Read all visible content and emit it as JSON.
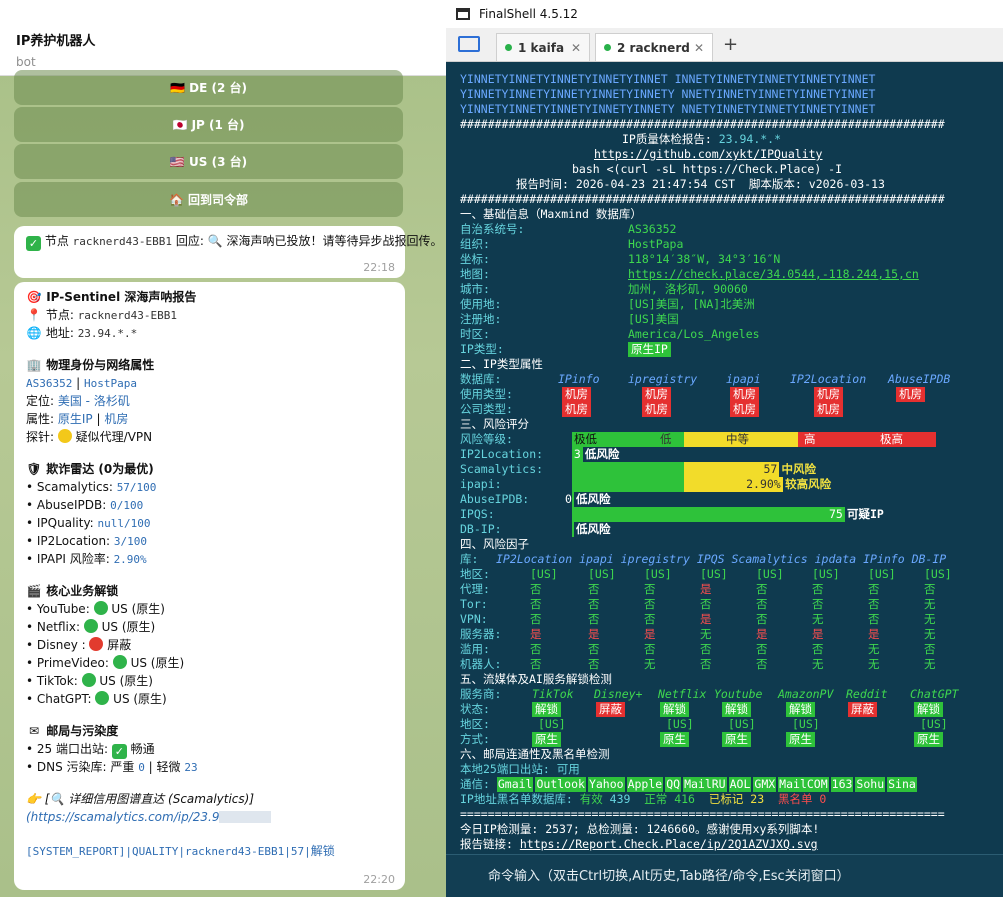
{
  "telegram": {
    "title": "IP养护机器人",
    "subtitle": "bot",
    "buttons": [
      "🇩🇪 DE (2 台)",
      "🇯🇵 JP (1 台)",
      "🇺🇸 US (3 台)",
      "🏠 回到司令部"
    ],
    "msg1": {
      "prefix": "节点 ",
      "node": "racknerd43-EBB1",
      "text1": " 回应: ",
      "text2": " 深海声呐已投放！请等待异步战报回传。",
      "time": "22:18"
    },
    "report": {
      "title": "IP-Sentinel 深海声呐报告",
      "node_label": "节点: ",
      "node": "racknerd43-EBB1",
      "addr_label": "地址: ",
      "addr": "23.94.*.*",
      "s1_title": "物理身份与网络属性",
      "asn": "AS36352",
      "sep": " | ",
      "org": "HostPapa",
      "loc_label": "定位: ",
      "loc": "美国 - 洛杉矶",
      "attr_label": "属性: ",
      "attr1": "原生IP",
      "attr2": "机房",
      "probe_label": "探针: ",
      "probe": " 疑似代理/VPN",
      "s2_title": "欺诈雷达 (0为最优)",
      "fraud": [
        {
          "name": "• Scamalytics: ",
          "value": "57/100"
        },
        {
          "name": "• AbuseIPDB: ",
          "value": "0/100"
        },
        {
          "name": "• IPQuality: ",
          "value": "null/100"
        },
        {
          "name": "• IP2Location: ",
          "value": "3/100"
        },
        {
          "name": "• IPAPI 风险率: ",
          "value": "2.90%"
        }
      ],
      "s3_title": "核心业务解锁",
      "unlock": [
        {
          "name": "• YouTube: ",
          "value": " US (原生)",
          "color": "#2fb34a"
        },
        {
          "name": "• Netflix: ",
          "value": " US (原生)",
          "color": "#2fb34a"
        },
        {
          "name": "• Disney : ",
          "value": " 屏蔽",
          "color": "#e23b2e"
        },
        {
          "name": "• PrimeVideo: ",
          "value": " US (原生)",
          "color": "#2fb34a"
        },
        {
          "name": "• TikTok: ",
          "value": " US (原生)",
          "color": "#2fb34a"
        },
        {
          "name": "• ChatGPT: ",
          "value": " US (原生)",
          "color": "#2fb34a"
        }
      ],
      "s4_title": "邮局与污染度",
      "port25_label": "• 25 端口出站: ",
      "port25": " 畅通",
      "dns_label": "• DNS 污染库: 严重 ",
      "dns_severe": "0",
      "dns_mid": " | 轻微 ",
      "dns_light": "23",
      "link_label": " [",
      "link_title": " 详细信用图谱直达 (Scamalytics)",
      "link_close": "]",
      "link_url": "(https://scamalytics.com/ip/23.9",
      "sys": "[SYSTEM_REPORT]|QUALITY|racknerd43-EBB1|57|",
      "sys_end": "解锁",
      "time": "22:20"
    }
  },
  "finalshell": {
    "title": "FinalShell 4.5.12",
    "tabs": [
      {
        "label": "1 kaifa"
      },
      {
        "label": "2 racknerd"
      }
    ],
    "banner": [
      "YINNETYINNETYINNETYINNETYINNET INNETYINNETYINNETYINNETYINNET",
      "YINNETYINNETYINNETYINNETYINNETY NNETYINNETYINNETYINNETYINNET",
      "YINNETYINNETYINNETYINNETYINNETY NNETYINNETYINNETYINNETYINNET"
    ],
    "hash": "######################################################################",
    "report_title_a": "IP质量体检报告: ",
    "report_title_b": "23.94.*.*",
    "repo": "https://github.com/xykt/IPQuality",
    "cmd": "bash <(curl -sL https://Check.Place) -I",
    "report_time": "报告时间: 2026-04-23 21:47:54 CST  脚本版本: v2026-03-13",
    "s1": "一、基础信息（Maxmind 数据库）",
    "basic": [
      {
        "k": "自治系统号:",
        "v": "AS36352"
      },
      {
        "k": "组织:",
        "v": "HostPapa"
      },
      {
        "k": "坐标:",
        "v": "118°14′38″W, 34°3′16″N"
      },
      {
        "k": "地图:",
        "v": "https://check.place/34.0544,-118.244,15,cn"
      },
      {
        "k": "城市:",
        "v": "加州, 洛杉矶, 90060"
      },
      {
        "k": "使用地:",
        "v": "[US]美国, [NA]北美洲"
      },
      {
        "k": "注册地:",
        "v": "[US]美国"
      },
      {
        "k": "时区:",
        "v": "America/Los_Angeles"
      },
      {
        "k": "IP类型:",
        "v": "原生IP"
      }
    ],
    "s2": "二、IP类型属性",
    "db_label": "数据库:",
    "dbs": [
      "IPinfo",
      "ipregistry",
      "ipapi",
      "IP2Location",
      "AbuseIPDB"
    ],
    "use_label": "使用类型:",
    "use_vals": [
      "机房",
      "机房",
      "机房",
      "机房",
      "机房"
    ],
    "co_label": "公司类型:",
    "co_vals": [
      "机房",
      "机房",
      "机房",
      "机房"
    ],
    "s3": "三、风险评分",
    "risk_level_label": "风险等级:",
    "risk_scale": [
      "极低",
      "低",
      "中等",
      "高",
      "极高"
    ],
    "scores": [
      {
        "k": "IP2Location:",
        "value": 3,
        "text": "3",
        "label": "低风险",
        "color": "#2ec23a"
      },
      {
        "k": "Scamalytics:",
        "value": 57,
        "text": "57",
        "label": "中风险",
        "color": "#f2dc2a"
      },
      {
        "k": "ipapi:",
        "value": 58,
        "text": "2.90%",
        "label": "较高风险",
        "color": "#f2dc2a"
      },
      {
        "k": "AbuseIPDB:",
        "value": 0,
        "text": "0",
        "label": "低风险",
        "color": "#2ec23a"
      },
      {
        "k": "IPQS:",
        "value": 75,
        "text": "75",
        "label": "可疑IP",
        "color": "#2ec23a"
      },
      {
        "k": "DB-IP:",
        "value": 0,
        "text": "",
        "label": "低风险",
        "color": "#2ec23a"
      }
    ],
    "s4": "四、风险因子",
    "factor_label": "库:",
    "factor_dbs": [
      "IP2Location",
      "ipapi",
      "ipregistry",
      "IPQS",
      "Scamalytics",
      "ipdata",
      "IPinfo",
      "DB-IP"
    ],
    "factors": [
      {
        "k": "地区:",
        "v": [
          "[US]",
          "[US]",
          "[US]",
          "[US]",
          "[US]",
          "[US]",
          "[US]",
          "[US]"
        ]
      },
      {
        "k": "代理:",
        "v": [
          "否",
          "否",
          "否",
          "是",
          "否",
          "否",
          "否",
          "否"
        ]
      },
      {
        "k": "Tor:",
        "v": [
          "否",
          "否",
          "否",
          "否",
          "否",
          "否",
          "否",
          "无"
        ]
      },
      {
        "k": "VPN:",
        "v": [
          "否",
          "否",
          "否",
          "是",
          "否",
          "无",
          "否",
          "无"
        ]
      },
      {
        "k": "服务器:",
        "v": [
          "是",
          "是",
          "是",
          "无",
          "是",
          "是",
          "是",
          "无"
        ]
      },
      {
        "k": "滥用:",
        "v": [
          "否",
          "否",
          "否",
          "否",
          "否",
          "否",
          "无",
          "否"
        ]
      },
      {
        "k": "机器人:",
        "v": [
          "否",
          "否",
          "无",
          "否",
          "否",
          "无",
          "无",
          "无"
        ]
      }
    ],
    "s5": "五、流媒体及AI服务解锁检测",
    "svc_label": "服务商:",
    "services": [
      "TikTok",
      "Disney+",
      "Netflix",
      "Youtube",
      "AmazonPV",
      "Reddit",
      "ChatGPT"
    ],
    "status_label": "状态:",
    "status": [
      "解锁",
      "屏蔽",
      "解锁",
      "解锁",
      "解锁",
      "屏蔽",
      "解锁"
    ],
    "region_label": "地区:",
    "regions": [
      "[US]",
      "",
      "[US]",
      "[US]",
      "[US]",
      "",
      "[US]"
    ],
    "mode_label": "方式:",
    "modes": [
      "原生",
      "",
      "原生",
      "原生",
      "原生",
      "",
      "原生"
    ],
    "s6": "六、邮局连通性及黑名单检测",
    "port25": "本地25端口出站: 可用",
    "mail_label": "通信: ",
    "mails": [
      "Gmail",
      "Outlook",
      "Yahoo",
      "Apple",
      "QQ",
      "MailRU",
      "AOL",
      "GMX",
      "MailCOM",
      "163",
      "Sohu",
      "Sina"
    ],
    "bl_label": "IP地址黑名单数据库:",
    "bl_valid_label": " 有效 ",
    "bl_valid": "439",
    "bl_normal_label": "  正常 ",
    "bl_normal": "416",
    "bl_marked_label": "  已标记 ",
    "bl_marked": "23",
    "bl_black_label": "  黑名单 ",
    "bl_black": "0",
    "hash2": "======================================================================",
    "footer1": "今日IP检测量: 2537; 总检测量: 1246660。感谢使用xy系列脚本!",
    "footer2_label": "报告链接: ",
    "footer2": "https://Report.Check.Place/ip/2Q1AZVJXQ.svg",
    "input_hint": "命令输入（双击Ctrl切换,Alt历史,Tab路径/命令,Esc关闭窗口）"
  }
}
